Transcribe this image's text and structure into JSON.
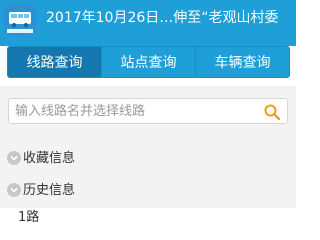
{
  "header": {
    "title": "2017年10月26日…伸至“老观山村委",
    "icon": "bus-app-icon"
  },
  "tabs": [
    {
      "label": "线路查询",
      "active": true
    },
    {
      "label": "站点查询",
      "active": false
    },
    {
      "label": "车辆查询",
      "active": false
    }
  ],
  "search": {
    "placeholder": "输入线路名并选择线路",
    "icon": "search-icon"
  },
  "sections": [
    {
      "label": "收藏信息",
      "icon": "chevron-down-icon"
    },
    {
      "label": "历史信息",
      "icon": "chevron-down-icon"
    }
  ],
  "history": {
    "first_item": "1路"
  },
  "colors": {
    "header_bg": "#1f9fd8",
    "tab_active_bg": "#1577b0",
    "search_icon": "#f29a1f"
  }
}
